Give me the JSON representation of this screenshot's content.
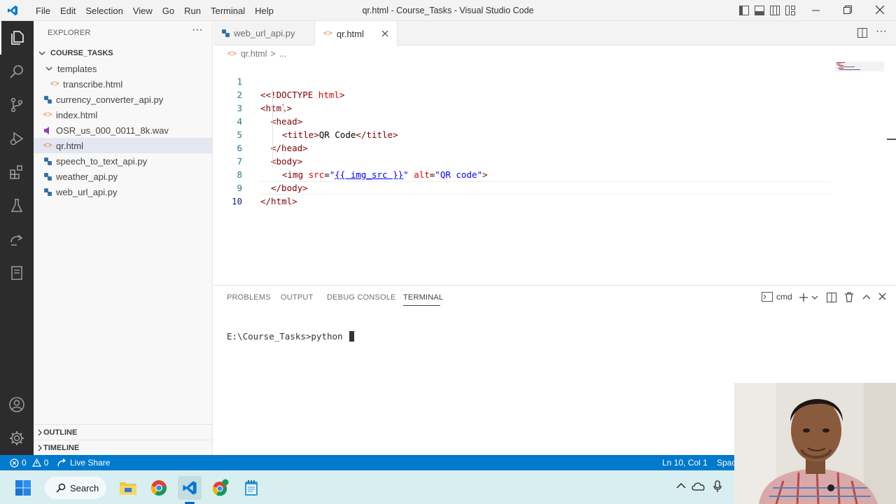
{
  "titlebar": {
    "menu": [
      "File",
      "Edit",
      "Selection",
      "View",
      "Go",
      "Run",
      "Terminal",
      "Help"
    ],
    "window_title": "qr.html - Course_Tasks - Visual Studio Code"
  },
  "sidebar": {
    "title": "EXPLORER",
    "more": "···",
    "root": "COURSE_TASKS",
    "folder": "templates",
    "folder_items": [
      {
        "label": "transcribe.html",
        "icon": "html-file-icon"
      }
    ],
    "files": [
      {
        "label": "currency_converter_api.py",
        "icon": "python-file-icon"
      },
      {
        "label": "index.html",
        "icon": "html-file-icon"
      },
      {
        "label": "OSR_us_000_0011_8k.wav",
        "icon": "audio-file-icon"
      },
      {
        "label": "qr.html",
        "icon": "html-file-icon",
        "selected": true
      },
      {
        "label": "speech_to_text_api.py",
        "icon": "python-file-icon"
      },
      {
        "label": "weather_api.py",
        "icon": "python-file-icon"
      },
      {
        "label": "web_url_api.py",
        "icon": "python-file-icon"
      }
    ],
    "outline": "OUTLINE",
    "timeline": "TIMELINE"
  },
  "tabs": [
    {
      "label": "web_url_api.py",
      "active": false
    },
    {
      "label": "qr.html",
      "active": true
    }
  ],
  "breadcrumb": {
    "file": "qr.html",
    "sep": ">",
    "rest": "..."
  },
  "editor": {
    "line_numbers": [
      "1",
      "2",
      "3",
      "4",
      "5",
      "6",
      "7",
      "8",
      "9",
      "10"
    ],
    "current_line": "10",
    "code": {
      "l1a": "<!DOCTYPE",
      "l1b": " html",
      "l1c": ">",
      "l2": "<html>",
      "l3": "<head>",
      "l4a": "<title>",
      "l4b": "QR Code",
      "l4c": "</title>",
      "l5": "</head>",
      "l6": "<body>",
      "l7a": "<img",
      "l7b": " src",
      "l7c": "=",
      "l7d": "\"",
      "l7e": "{{ img_src }}",
      "l7f": "\"",
      "l7g": " alt",
      "l7h": "=",
      "l7i": "\"QR code\"",
      "l7j": ">",
      "l8": "</body>",
      "l9": "</html>"
    }
  },
  "panel": {
    "tabs": [
      "PROBLEMS",
      "OUTPUT",
      "DEBUG CONSOLE",
      "TERMINAL"
    ],
    "active_tab": "TERMINAL",
    "terminal_name": "cmd",
    "terminal_prompt": "E:\\Course_Tasks>python "
  },
  "statusbar": {
    "errors": "0",
    "warnings": "0",
    "live_share": "Live Share",
    "position": "Ln 10, Col 1",
    "spaces": "Spac"
  },
  "taskbar": {
    "search": "Search"
  },
  "colors": {
    "accent": "#007acc",
    "activity_bar": "#2c2c2c",
    "taskbar": "#d9eef0"
  }
}
